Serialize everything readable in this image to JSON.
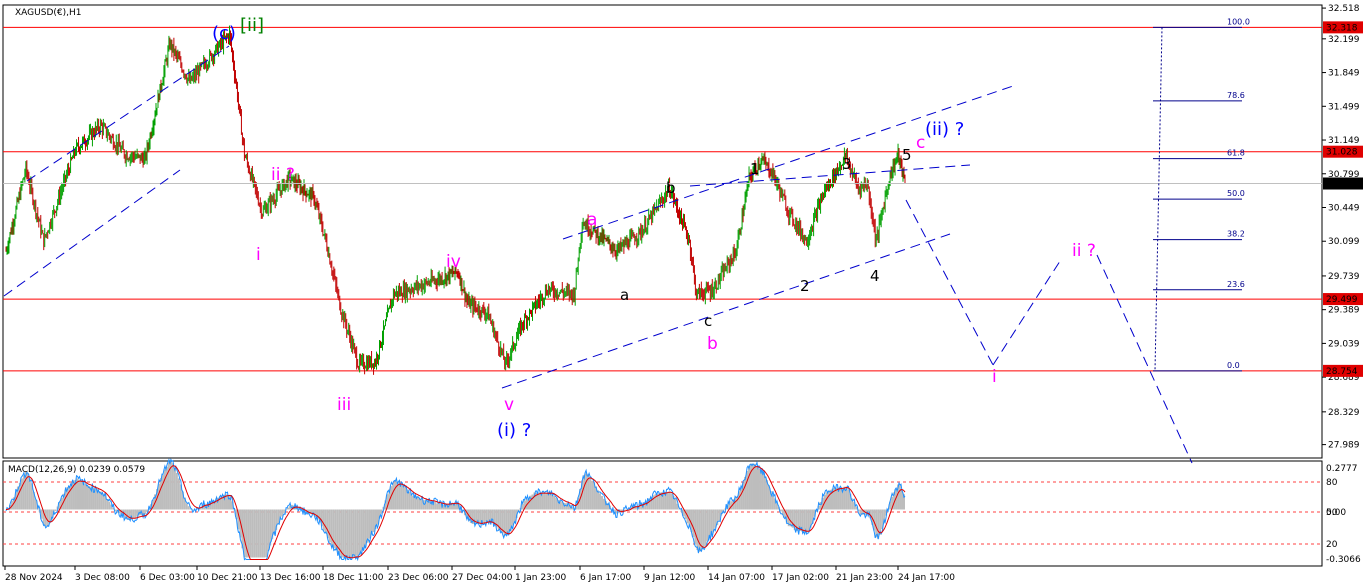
{
  "colors": {
    "background": "#ffffff",
    "bull_candle": "#00a000",
    "bear_candle": "#c00000",
    "hline": "#ff0000",
    "trend": "#0000cd",
    "fib": "#00008b",
    "macd_hist": "#bdbdbd",
    "macd_main": "#1e90ff",
    "macd_signal": "#e00000",
    "price_tag_red": "#e00000",
    "price_tag_black": "#000000"
  },
  "chart_data": [
    {
      "type": "candlestick",
      "title": "XAGUSD(€),H1",
      "ylim": [
        27.85,
        32.55
      ],
      "y_ticks": [
        "32.518",
        "32.199",
        "31.849",
        "31.499",
        "31.149",
        "30.799",
        "30.449",
        "30.099",
        "29.739",
        "29.389",
        "29.039",
        "28.689",
        "28.329",
        "27.989"
      ],
      "x_ticks": [
        "28 Nov 2024",
        "3 Dec 08:00",
        "6 Dec 03:00",
        "10 Dec 21:00",
        "13 Dec 16:00",
        "18 Dec 11:00",
        "23 Dec 06:00",
        "27 Dec 04:00",
        "1 Jan 23:00",
        "6 Jan 17:00",
        "9 Jan 12:00",
        "14 Jan 07:00",
        "17 Jan 02:00",
        "21 Jan 23:00",
        "24 Jan 17:00"
      ],
      "price_path_key_points": [
        {
          "idx": 0,
          "p": 30.0
        },
        {
          "idx": 20,
          "p": 30.85
        },
        {
          "idx": 38,
          "p": 30.1
        },
        {
          "idx": 70,
          "p": 31.05
        },
        {
          "idx": 95,
          "p": 31.3
        },
        {
          "idx": 120,
          "p": 31.0
        },
        {
          "idx": 140,
          "p": 30.95
        },
        {
          "idx": 165,
          "p": 32.15
        },
        {
          "idx": 185,
          "p": 31.75
        },
        {
          "idx": 205,
          "p": 32.0
        },
        {
          "idx": 225,
          "p": 32.25
        },
        {
          "idx": 232,
          "p": 31.7
        },
        {
          "idx": 240,
          "p": 31.0
        },
        {
          "idx": 258,
          "p": 30.4
        },
        {
          "idx": 285,
          "p": 30.75
        },
        {
          "idx": 310,
          "p": 30.55
        },
        {
          "idx": 322,
          "p": 30.1
        },
        {
          "idx": 337,
          "p": 29.4
        },
        {
          "idx": 355,
          "p": 28.82
        },
        {
          "idx": 372,
          "p": 28.85
        },
        {
          "idx": 390,
          "p": 29.55
        },
        {
          "idx": 420,
          "p": 29.65
        },
        {
          "idx": 455,
          "p": 29.78
        },
        {
          "idx": 465,
          "p": 29.45
        },
        {
          "idx": 485,
          "p": 29.35
        },
        {
          "idx": 503,
          "p": 28.82
        },
        {
          "idx": 520,
          "p": 29.25
        },
        {
          "idx": 545,
          "p": 29.6
        },
        {
          "idx": 572,
          "p": 29.55
        },
        {
          "idx": 580,
          "p": 30.3
        },
        {
          "idx": 592,
          "p": 30.2
        },
        {
          "idx": 615,
          "p": 30.0
        },
        {
          "idx": 640,
          "p": 30.2
        },
        {
          "idx": 668,
          "p": 30.65
        },
        {
          "idx": 688,
          "p": 30.1
        },
        {
          "idx": 695,
          "p": 29.55
        },
        {
          "idx": 712,
          "p": 29.6
        },
        {
          "idx": 735,
          "p": 30.0
        },
        {
          "idx": 748,
          "p": 30.75
        },
        {
          "idx": 760,
          "p": 30.95
        },
        {
          "idx": 772,
          "p": 30.8
        },
        {
          "idx": 788,
          "p": 30.4
        },
        {
          "idx": 806,
          "p": 30.1
        },
        {
          "idx": 823,
          "p": 30.6
        },
        {
          "idx": 845,
          "p": 30.98
        },
        {
          "idx": 858,
          "p": 30.65
        },
        {
          "idx": 867,
          "p": 30.7
        },
        {
          "idx": 876,
          "p": 30.1
        },
        {
          "idx": 889,
          "p": 30.75
        },
        {
          "idx": 898,
          "p": 31.0
        },
        {
          "idx": 905,
          "p": 30.7
        }
      ],
      "horizontal_levels": [
        {
          "price": 32.318,
          "label": "32.318"
        },
        {
          "price": 31.028,
          "label": "31.028"
        },
        {
          "price": 29.499,
          "label": "29.499"
        },
        {
          "price": 28.754,
          "label": "28.754"
        }
      ],
      "current_price": {
        "price": 30.698,
        "label": "30.698"
      },
      "fibonacci": {
        "from": 28.754,
        "to": 32.318,
        "levels": [
          {
            "ratio": 1.0,
            "label": "100.0"
          },
          {
            "ratio": 0.786,
            "label": "78.6"
          },
          {
            "ratio": 0.618,
            "label": "61.8"
          },
          {
            "ratio": 0.5,
            "label": "50.0"
          },
          {
            "ratio": 0.382,
            "label": "38.2"
          },
          {
            "ratio": 0.236,
            "label": "23.6"
          },
          {
            "ratio": 0.0,
            "label": "0.0"
          }
        ]
      },
      "wave_labels": {
        "c_ii": {
          "blue": "(c)",
          "green": "[ii]"
        },
        "ii_q_1": "ii ?",
        "i_1": "i",
        "iii": "iii",
        "iv": "iv",
        "v": "v",
        "i_q": "(i) ?",
        "a_mag": "a",
        "b_mag": "b",
        "a_blk": "a",
        "b_blk": "b",
        "c_blk": "c",
        "w1": "1",
        "w2": "2",
        "w3": "3",
        "w4": "4",
        "w5": "5",
        "c_mag": "c",
        "ii_q_blue": "(ii) ?",
        "i_proj": "i",
        "ii_q_proj": "ii ?"
      }
    },
    {
      "type": "line",
      "title": "MACD(12,26,9) 0.0239 0.0579",
      "y_ticks": [
        "0.2777",
        "0.00",
        "-0.3066"
      ],
      "levels": [
        "80",
        "50",
        "20"
      ],
      "series": [
        "MACD main",
        "Signal"
      ]
    }
  ]
}
